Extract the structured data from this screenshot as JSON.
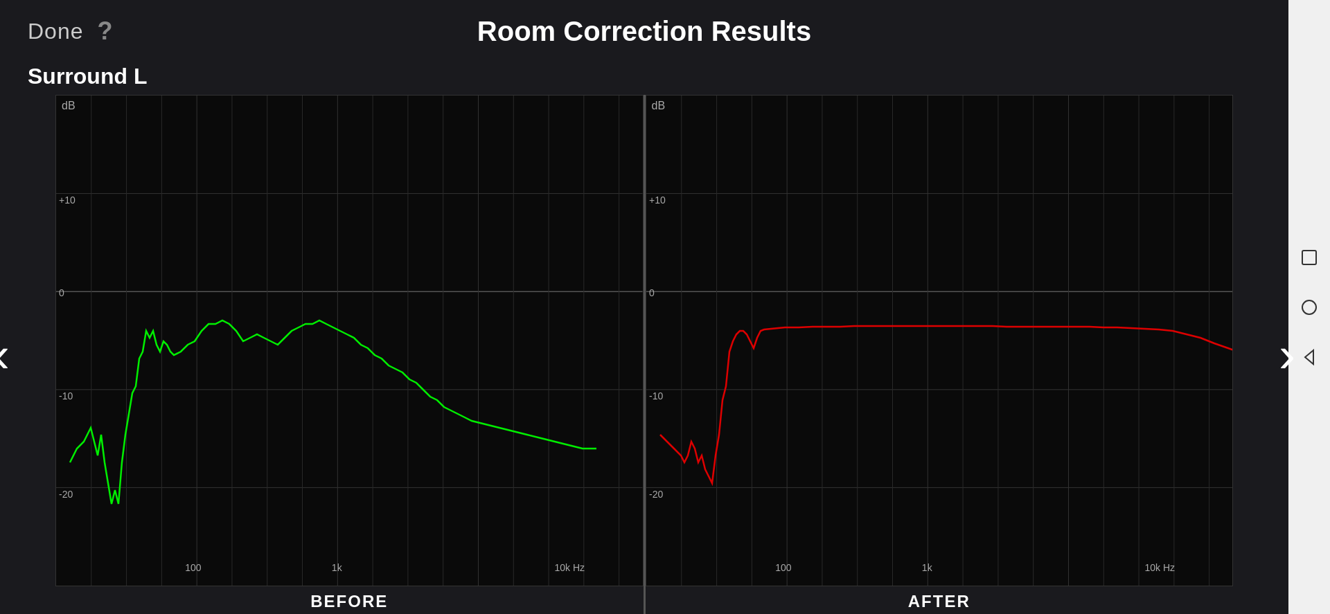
{
  "header": {
    "done_label": "Done",
    "help_icon": "?",
    "title": "Room Correction Results"
  },
  "channel": {
    "name": "Surround L"
  },
  "before_chart": {
    "db_label": "dB",
    "y_labels": [
      "+10",
      "0",
      "-10",
      "-20"
    ],
    "x_labels": [
      "100",
      "1k",
      "10k Hz"
    ],
    "footer_label": "BEFORE"
  },
  "after_chart": {
    "db_label": "dB",
    "y_labels": [
      "+10",
      "0",
      "-10",
      "-20"
    ],
    "x_labels": [
      "100",
      "1k",
      "10k Hz"
    ],
    "footer_label": "AFTER"
  },
  "nav": {
    "left_arrow": "‹",
    "right_arrow": "›"
  },
  "sidebar": {
    "icons": [
      "square",
      "circle",
      "triangle-left"
    ]
  }
}
